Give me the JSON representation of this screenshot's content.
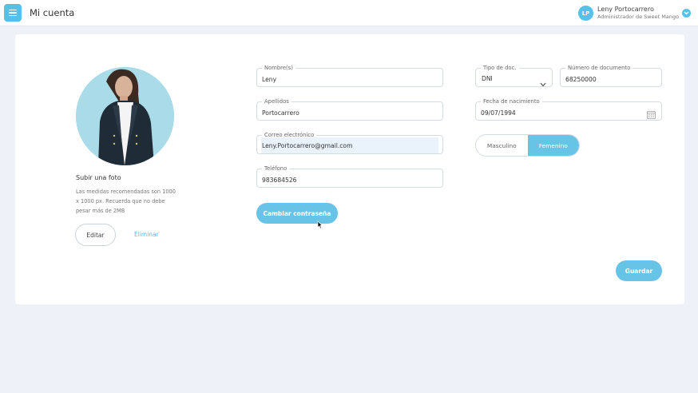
{
  "header": {
    "title": "Mi cuenta",
    "user": {
      "initials": "LP",
      "name": "Leny Portocarrero",
      "role": "Administrador de Sweet Mango"
    }
  },
  "photo_panel": {
    "title": "Subir una foto",
    "hint": "Las medidas recomendadas son 1000 x 1000 px. Recuerda que no debe pesar más de 2MB",
    "edit_label": "Editar",
    "delete_label": "Eliminar"
  },
  "form": {
    "nombres": {
      "label": "Nombre(s)",
      "value": "Leny"
    },
    "apellidos": {
      "label": "Apellidos",
      "value": "Portocarrero"
    },
    "correo": {
      "label": "Correo electrónico",
      "value": "Leny.Portocarrero@gmail.com"
    },
    "telefono": {
      "label": "Teléfono",
      "value": "983684526"
    },
    "tipo_doc": {
      "label": "Tipo de doc.",
      "value": "DNI"
    },
    "numero_doc": {
      "label": "Número de documento",
      "value": "68250000"
    },
    "fecha_nacimiento": {
      "label": "Fecha de nacimiento",
      "value": "09/07/1994"
    },
    "genero": {
      "options": [
        "Masculino",
        "Femenino"
      ],
      "selected": "Femenino"
    },
    "change_password_label": "Cambiar contraseña",
    "save_label": "Guardar"
  },
  "colors": {
    "accent": "#56c1e8",
    "background": "#eef1f7"
  }
}
